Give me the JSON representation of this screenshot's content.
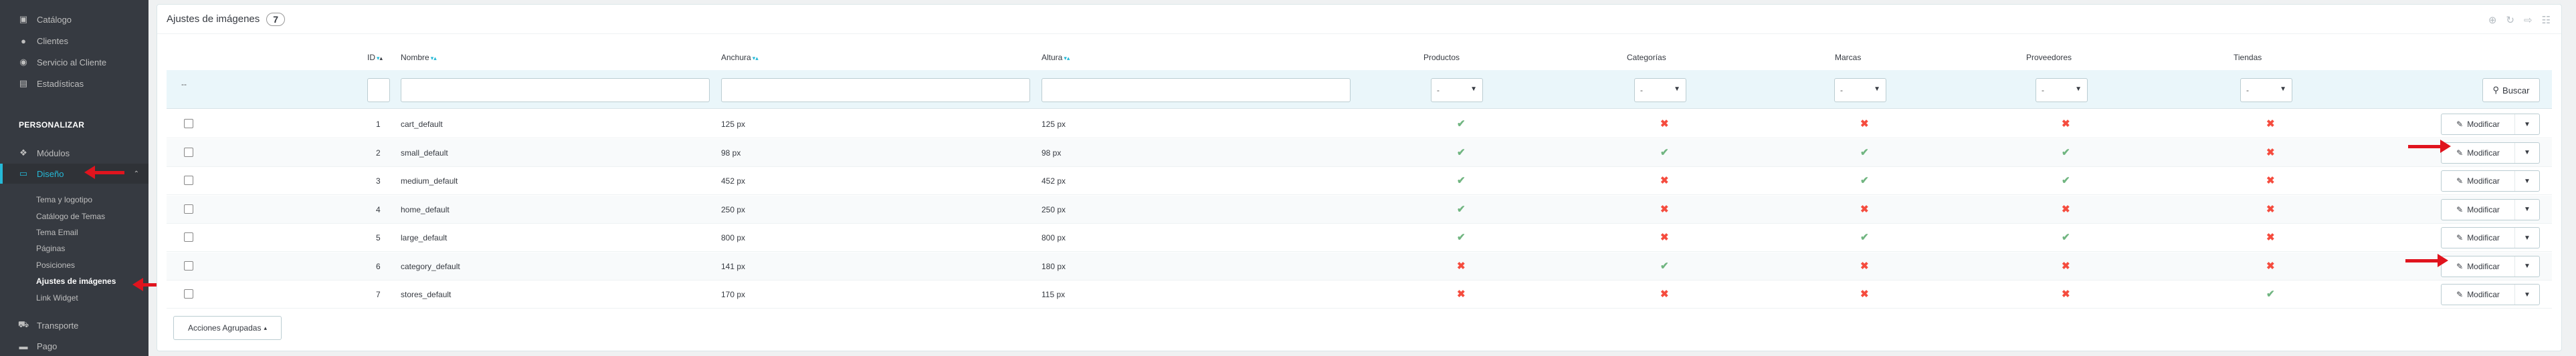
{
  "sidebar": {
    "top_items": [
      {
        "label": "Catálogo",
        "icon": "store-icon"
      },
      {
        "label": "Clientes",
        "icon": "account-circle-icon"
      },
      {
        "label": "Servicio al Cliente",
        "icon": "chat-icon"
      },
      {
        "label": "Estadísticas",
        "icon": "bar-chart-icon"
      }
    ],
    "section_label": "PERSONALIZAR",
    "modules_label": "Módulos",
    "design_label": "Diseño",
    "design_subitems": [
      "Tema y logotipo",
      "Catálogo de Temas",
      "Tema Email",
      "Páginas",
      "Posiciones",
      "Ajustes de imágenes",
      "Link Widget"
    ],
    "active_subitem": "Ajustes de imágenes",
    "bottom_items": [
      {
        "label": "Transporte",
        "icon": "truck-icon"
      },
      {
        "label": "Pago",
        "icon": "credit-card-icon"
      }
    ],
    "active_color": "#25b9d7"
  },
  "panel": {
    "title": "Ajustes de imágenes",
    "count": "7"
  },
  "table": {
    "headers": {
      "id": "ID",
      "name": "Nombre",
      "width": "Anchura",
      "height": "Altura",
      "products": "Productos",
      "categories": "Categorías",
      "brands": "Marcas",
      "suppliers": "Proveedores",
      "stores": "Tiendas"
    },
    "filter_dash": "--",
    "select_placeholder": "-",
    "search_label": "Buscar",
    "modify_label": "Modificar",
    "rows": [
      {
        "id": "1",
        "name": "cart_default",
        "width": "125 px",
        "height": "125 px",
        "products": true,
        "categories": false,
        "brands": false,
        "suppliers": false,
        "stores": false
      },
      {
        "id": "2",
        "name": "small_default",
        "width": "98 px",
        "height": "98 px",
        "products": true,
        "categories": true,
        "brands": true,
        "suppliers": true,
        "stores": false
      },
      {
        "id": "3",
        "name": "medium_default",
        "width": "452 px",
        "height": "452 px",
        "products": true,
        "categories": false,
        "brands": true,
        "suppliers": true,
        "stores": false
      },
      {
        "id": "4",
        "name": "home_default",
        "width": "250 px",
        "height": "250 px",
        "products": true,
        "categories": false,
        "brands": false,
        "suppliers": false,
        "stores": false
      },
      {
        "id": "5",
        "name": "large_default",
        "width": "800 px",
        "height": "800 px",
        "products": true,
        "categories": false,
        "brands": true,
        "suppliers": true,
        "stores": false
      },
      {
        "id": "6",
        "name": "category_default",
        "width": "141 px",
        "height": "180 px",
        "products": false,
        "categories": true,
        "brands": false,
        "suppliers": false,
        "stores": false
      },
      {
        "id": "7",
        "name": "stores_default",
        "width": "170 px",
        "height": "115 px",
        "products": false,
        "categories": false,
        "brands": false,
        "suppliers": false,
        "stores": true
      }
    ],
    "bulk_actions_label": "Acciones Agrupadas"
  },
  "colors": {
    "yes": "#70b580",
    "no": "#f54c3e",
    "annotation_arrow": "#e0141e"
  }
}
